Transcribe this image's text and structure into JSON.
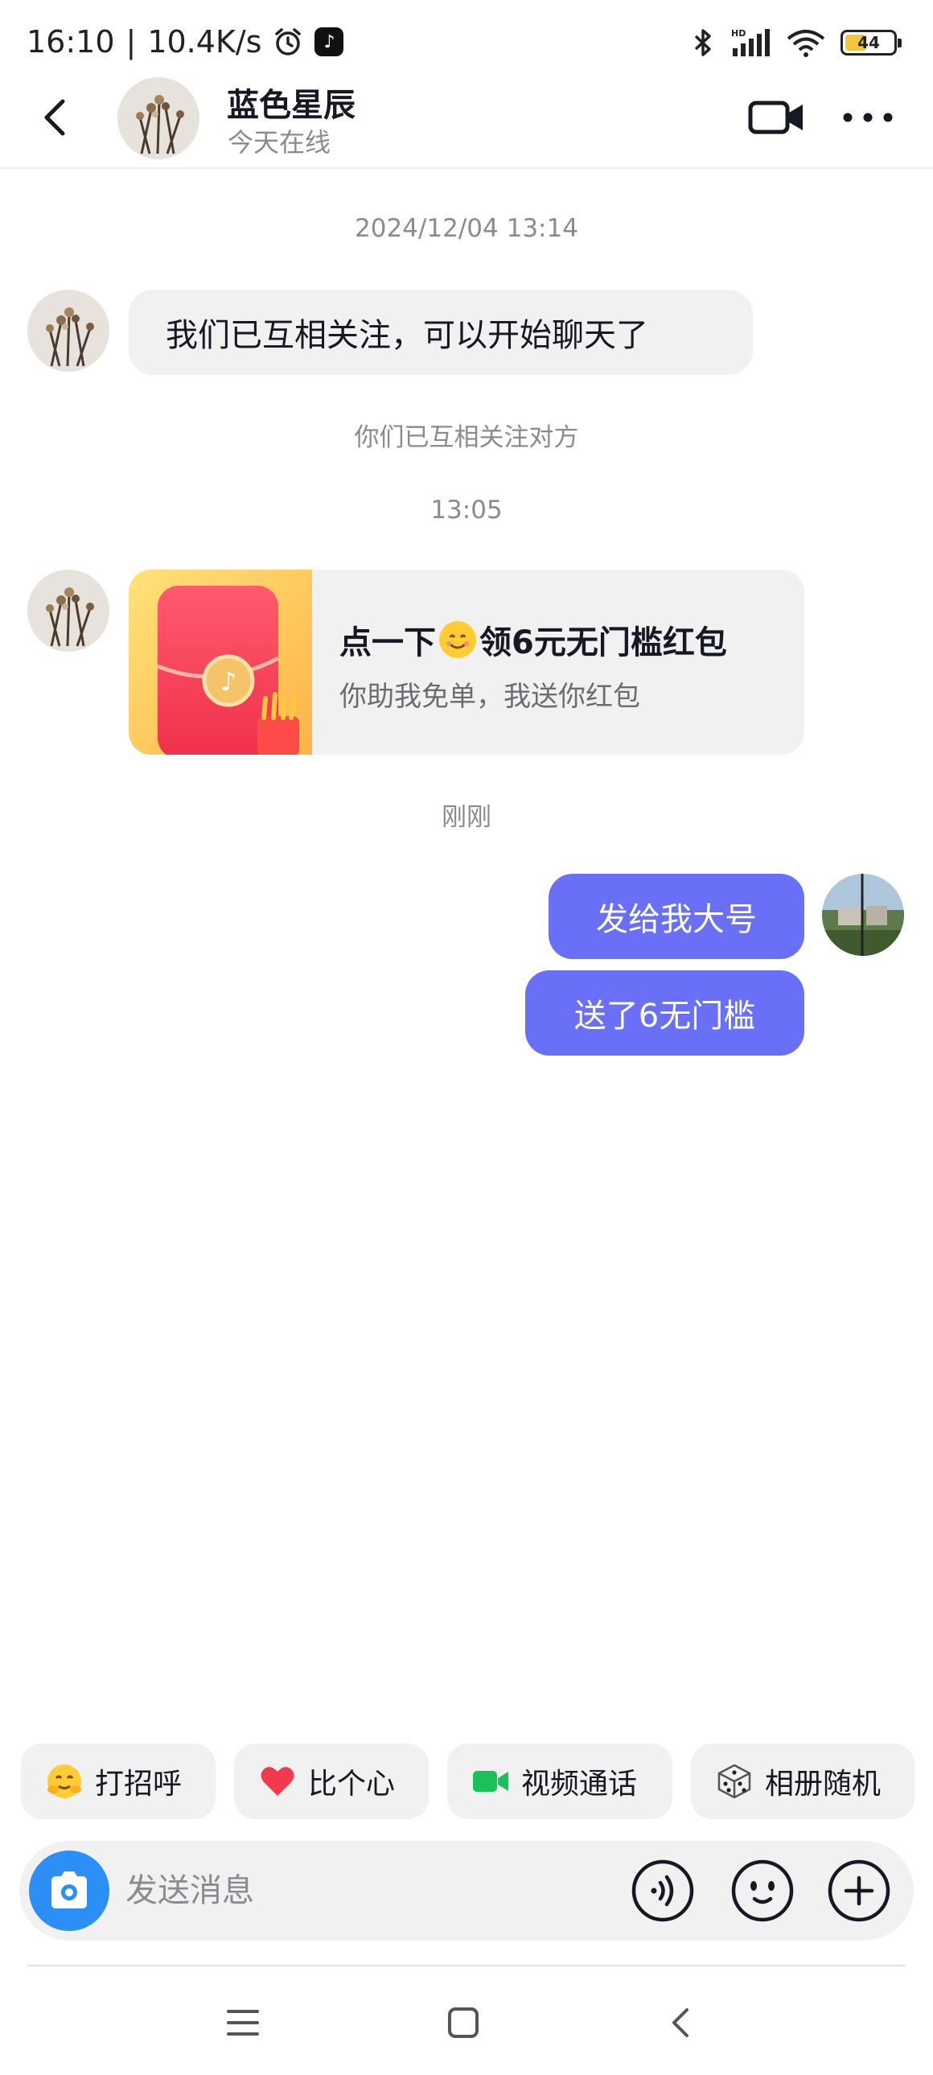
{
  "status_bar": {
    "time": "16:10",
    "net_speed": "10.4K/s",
    "battery": "44",
    "battery_level": 0.44,
    "accent": "#f4c63d"
  },
  "header": {
    "contact_name": "蓝色星辰",
    "contact_status": "今天在线"
  },
  "chat": {
    "timestamp_1": "2024/12/04 13:14",
    "message_1": "我们已互相关注，可以开始聊天了",
    "system_notice": "你们已互相关注对方",
    "timestamp_2": "13:05",
    "card": {
      "title_part1": "点一下",
      "title_part2": "领6元无门槛红包",
      "subtitle": "你助我免单，我送你红包"
    },
    "timestamp_3": "刚刚",
    "my_message_1": "发给我大号",
    "my_message_2": "送了6无门槛",
    "my_bubble_color": "#6a6ff7"
  },
  "quick_actions": [
    {
      "label": "打招呼",
      "icon": "hug-emoji-icon"
    },
    {
      "label": "比个心",
      "icon": "heart-icon"
    },
    {
      "label": "视频通话",
      "icon": "video-call-icon"
    },
    {
      "label": "相册随机",
      "icon": "dice-icon"
    }
  ],
  "input": {
    "placeholder": "发送消息"
  }
}
